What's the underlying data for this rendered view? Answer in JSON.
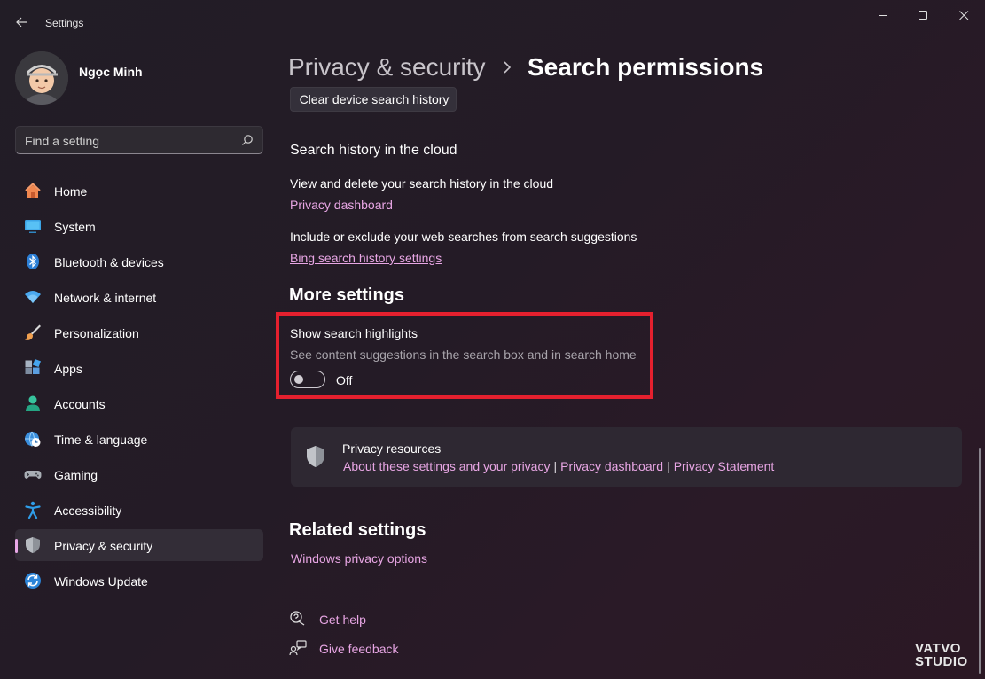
{
  "window": {
    "title": "Settings"
  },
  "user": {
    "name": "Ngọc Minh"
  },
  "search": {
    "placeholder": "Find a setting"
  },
  "sidebar": {
    "items": [
      {
        "label": "Home",
        "icon": "home-icon"
      },
      {
        "label": "System",
        "icon": "system-icon"
      },
      {
        "label": "Bluetooth & devices",
        "icon": "bluetooth-icon"
      },
      {
        "label": "Network & internet",
        "icon": "wifi-icon"
      },
      {
        "label": "Personalization",
        "icon": "brush-icon"
      },
      {
        "label": "Apps",
        "icon": "apps-icon"
      },
      {
        "label": "Accounts",
        "icon": "accounts-icon"
      },
      {
        "label": "Time & language",
        "icon": "globe-clock-icon"
      },
      {
        "label": "Gaming",
        "icon": "gamepad-icon"
      },
      {
        "label": "Accessibility",
        "icon": "accessibility-icon"
      },
      {
        "label": "Privacy & security",
        "icon": "shield-icon",
        "selected": true
      },
      {
        "label": "Windows Update",
        "icon": "update-icon"
      }
    ]
  },
  "breadcrumb": {
    "parent": "Privacy & security",
    "current": "Search permissions"
  },
  "history": {
    "clear_button": "Clear device search history",
    "cloud_heading": "Search history in the cloud",
    "cloud_desc": "View and delete your search history in the cloud",
    "privacy_dashboard_link": "Privacy dashboard",
    "include_desc": "Include or exclude your web searches from search suggestions",
    "bing_link": "Bing search history settings"
  },
  "more_settings": {
    "heading": "More settings",
    "highlights_title": "Show search highlights",
    "highlights_desc": "See content suggestions in the search box and in search home",
    "toggle_state": "Off",
    "toggle_on": false
  },
  "privacy_resources": {
    "title": "Privacy resources",
    "links": [
      "About these settings and your privacy",
      "Privacy dashboard",
      "Privacy Statement"
    ],
    "separator": "|"
  },
  "related": {
    "heading": "Related settings",
    "link": "Windows privacy options"
  },
  "help": {
    "get_help": "Get help",
    "give_feedback": "Give feedback"
  },
  "watermark": {
    "line1": "VATVO",
    "line2": "STUDIO"
  },
  "colors": {
    "accent_link": "#e8a6e4",
    "selected_indicator": "#e8a7e6",
    "highlight_box": "#e5202e"
  }
}
